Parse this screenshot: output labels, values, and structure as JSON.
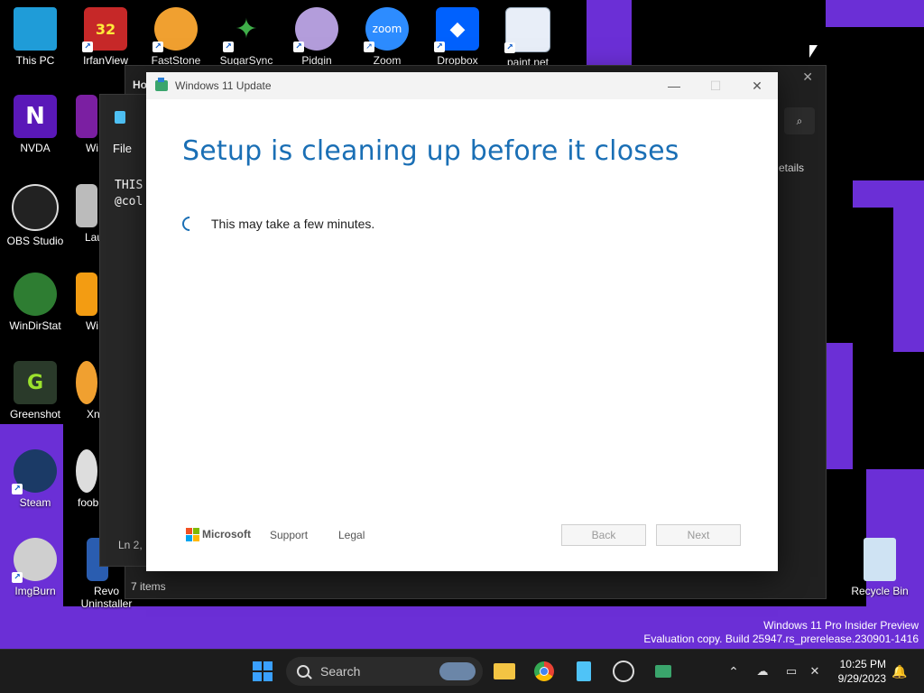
{
  "desktop": {
    "icons": [
      {
        "label": "This PC"
      },
      {
        "label": "IrfanView"
      },
      {
        "label": "FastStone"
      },
      {
        "label": "SugarSync"
      },
      {
        "label": "Pidgin"
      },
      {
        "label": "Zoom"
      },
      {
        "label": "Dropbox"
      },
      {
        "label": "paint.net"
      },
      {
        "label": "NVDA"
      },
      {
        "label": "OBS Studio"
      },
      {
        "label": "WinDirStat"
      },
      {
        "label": "Greenshot"
      },
      {
        "label": "Steam"
      },
      {
        "label": "ImgBurn"
      },
      {
        "label": "Wi"
      },
      {
        "label": "Lau"
      },
      {
        "label": "Wi"
      },
      {
        "label": "Xn"
      },
      {
        "label": "foob"
      },
      {
        "label": "Revo Uninstaller"
      },
      {
        "label": "Recycle Bin"
      }
    ],
    "irfan_badge": "32",
    "zoom_text": "zoom"
  },
  "background_windows": {
    "notepad": {
      "menu_file": "File",
      "text_line1": "THIS",
      "text_line2": "@col",
      "status": "Ln 2,"
    },
    "explorer": {
      "tab": "Ho",
      "details": "etails",
      "status": "7 items"
    }
  },
  "dialog": {
    "title": "Windows 11 Update",
    "heading": "Setup is cleaning up before it closes",
    "progress_text": "This may take a few minutes.",
    "brand": "Microsoft",
    "support": "Support",
    "legal": "Legal",
    "back": "Back",
    "next": "Next"
  },
  "watermark": {
    "line1": "Windows 11 Pro Insider Preview",
    "line2": "Evaluation copy. Build 25947.rs_prerelease.230901-1416"
  },
  "taskbar": {
    "search_placeholder": "Search",
    "time": "10:25 PM",
    "date": "9/29/2023"
  },
  "colors": {
    "wallpaper_purple": "#6b2fd6",
    "heading_blue": "#1a6fb5",
    "taskbar": "#1c1c1c"
  }
}
